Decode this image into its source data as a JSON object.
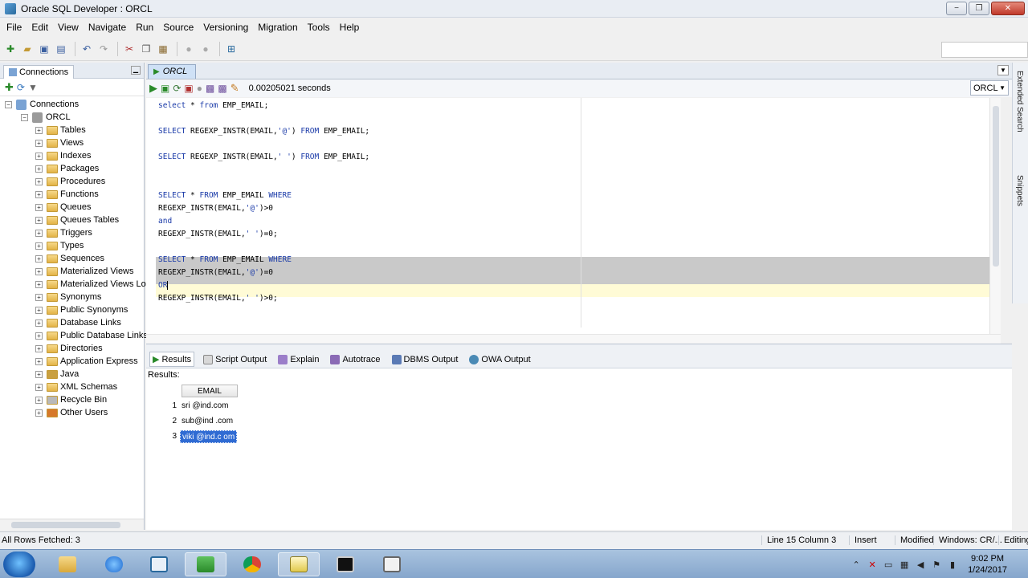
{
  "window": {
    "title": "Oracle SQL Developer : ORCL",
    "minimize": "−",
    "restore": "❐",
    "close": "✕"
  },
  "menu": [
    "File",
    "Edit",
    "View",
    "Navigate",
    "Run",
    "Source",
    "Versioning",
    "Migration",
    "Tools",
    "Help"
  ],
  "left_panel": {
    "tab": "Connections",
    "root": "Connections",
    "connection": "ORCL",
    "items": [
      "Tables",
      "Views",
      "Indexes",
      "Packages",
      "Procedures",
      "Functions",
      "Queues",
      "Queues Tables",
      "Triggers",
      "Types",
      "Sequences",
      "Materialized Views",
      "Materialized Views Lo",
      "Synonyms",
      "Public Synonyms",
      "Database Links",
      "Public Database Links",
      "Directories",
      "Application Express",
      "Java",
      "XML Schemas",
      "Recycle Bin",
      "Other Users"
    ]
  },
  "editor": {
    "tab": "ORCL",
    "timing": "0.00205021 seconds",
    "connection_select": "ORCL",
    "lines": [
      "select * from EMP_EMAIL;",
      "SELECT REGEXP_INSTR(EMAIL,'@') FROM EMP_EMAIL;",
      "SELECT REGEXP_INSTR(EMAIL,' ') FROM EMP_EMAIL;",
      "SELECT * FROM EMP_EMAIL WHERE",
      "REGEXP_INSTR(EMAIL,'@')>0",
      "and",
      "REGEXP_INSTR(EMAIL,' ')=0;",
      "SELECT * FROM EMP_EMAIL WHERE",
      "REGEXP_INSTR(EMAIL,'@')=0",
      "OR",
      "REGEXP_INSTR(EMAIL,' ')>0;"
    ]
  },
  "side_strip": {
    "extended_search": "Extended Search",
    "snippets": "Snippets"
  },
  "results": {
    "tabs": [
      "Results",
      "Script Output",
      "Explain",
      "Autotrace",
      "DBMS Output",
      "OWA Output"
    ],
    "label": "Results:",
    "column": "EMAIL",
    "rows": [
      {
        "num": "1",
        "email": "sri @ind.com"
      },
      {
        "num": "2",
        "email": "sub@ind .com"
      },
      {
        "num": "3",
        "email": "viki @ind.c om"
      }
    ]
  },
  "status": {
    "left": "All Rows Fetched: 3",
    "position": "Line 15 Column 3",
    "mode": "Insert",
    "modified": "Modified",
    "platform": "Windows: CR/...",
    "editing": "Editing"
  },
  "taskbar": {
    "time": "9:02 PM",
    "date": "1/24/2017"
  }
}
